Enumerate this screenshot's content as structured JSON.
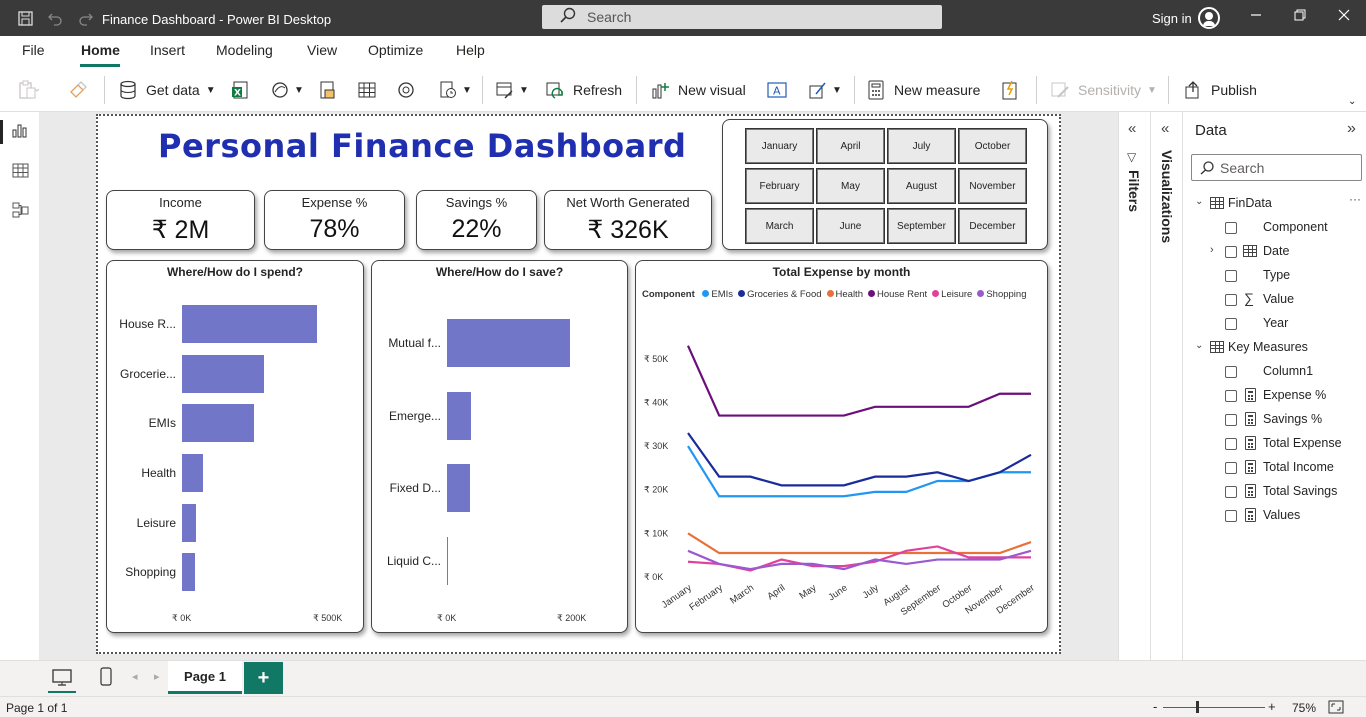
{
  "window": {
    "title": "Finance Dashboard - Power BI Desktop",
    "search_placeholder": "Search",
    "sign_in": "Sign in"
  },
  "menu": [
    "File",
    "Home",
    "Insert",
    "Modeling",
    "View",
    "Optimize",
    "Help"
  ],
  "ribbon": {
    "get_data": "Get data",
    "refresh": "Refresh",
    "new_visual": "New visual",
    "new_measure": "New measure",
    "sensitivity": "Sensitivity",
    "publish": "Publish"
  },
  "dashboard": {
    "title": "Personal Finance Dashboard",
    "kpis": [
      {
        "label": "Income",
        "value": "₹ 2M"
      },
      {
        "label": "Expense %",
        "value": "78%"
      },
      {
        "label": "Savings %",
        "value": "22%"
      },
      {
        "label": "Net Worth Generated",
        "value": "₹ 326K"
      }
    ],
    "months": [
      "January",
      "April",
      "July",
      "October",
      "February",
      "May",
      "August",
      "November",
      "March",
      "June",
      "September",
      "December"
    ]
  },
  "chart_data": [
    {
      "type": "bar",
      "title": "Where/How do I spend?",
      "categories": [
        "House R...",
        "Grocerie...",
        "EMIs",
        "Health",
        "Leisure",
        "Shopping"
      ],
      "values": [
        480000,
        290000,
        255000,
        75000,
        50000,
        45000
      ],
      "xlim": [
        0,
        560000
      ],
      "xticks": [
        "₹ 0K",
        "₹ 500K"
      ],
      "color": "#7276c8"
    },
    {
      "type": "bar",
      "title": "Where/How do I save?",
      "categories": [
        "Mutual f...",
        "Emerge...",
        "Fixed D...",
        "Liquid C..."
      ],
      "values": [
        205000,
        40000,
        38000,
        2000
      ],
      "xlim": [
        0,
        240000
      ],
      "xticks": [
        "₹ 0K",
        "₹ 200K"
      ],
      "color": "#7276c8"
    },
    {
      "type": "line",
      "title": "Total Expense by month",
      "legend_title": "Component",
      "x": [
        "January",
        "February",
        "March",
        "April",
        "May",
        "June",
        "July",
        "August",
        "September",
        "October",
        "November",
        "December"
      ],
      "ylim": [
        0,
        55000
      ],
      "yticks": [
        "₹ 0K",
        "₹ 10K",
        "₹ 20K",
        "₹ 30K",
        "₹ 40K",
        "₹ 50K"
      ],
      "series": [
        {
          "name": "EMIs",
          "color": "#2196f3",
          "values": [
            30000,
            18500,
            18500,
            18500,
            18500,
            18500,
            19500,
            19500,
            22000,
            22000,
            24000,
            24000
          ]
        },
        {
          "name": "Groceries & Food",
          "color": "#1a2b9a",
          "values": [
            33000,
            23000,
            23000,
            21000,
            21000,
            21000,
            23000,
            23000,
            24000,
            22000,
            24000,
            28000
          ]
        },
        {
          "name": "Health",
          "color": "#e8703a",
          "values": [
            10000,
            5500,
            5500,
            5500,
            5500,
            5500,
            5500,
            5500,
            5500,
            5500,
            5500,
            8000
          ]
        },
        {
          "name": "House Rent",
          "color": "#6b0f7a",
          "values": [
            53000,
            37000,
            37000,
            37000,
            37000,
            37000,
            39000,
            39000,
            39000,
            39000,
            42000,
            42000
          ]
        },
        {
          "name": "Leisure",
          "color": "#e0429b",
          "values": [
            3500,
            3000,
            1500,
            4000,
            2500,
            2500,
            3500,
            6000,
            7000,
            4500,
            4500,
            4500
          ]
        },
        {
          "name": "Shopping",
          "color": "#9b59d0",
          "values": [
            6000,
            3000,
            1800,
            3000,
            3000,
            1800,
            4000,
            3000,
            4000,
            4000,
            4000,
            6000
          ]
        }
      ]
    }
  ],
  "panels": {
    "filters": "Filters",
    "visualizations": "Visualizations",
    "data": "Data",
    "search_placeholder": "Search"
  },
  "data_fields": {
    "table1": "FinData",
    "table1_fields": [
      "Component",
      "Date",
      "Type",
      "Value",
      "Year"
    ],
    "table2": "Key Measures",
    "table2_fields": [
      "Column1",
      "Expense %",
      "Savings %",
      "Total Expense",
      "Total Income",
      "Total Savings",
      "Values"
    ]
  },
  "pages": {
    "current": "Page 1",
    "add": "+"
  },
  "status": {
    "page": "Page 1 of 1",
    "zoom": "75%",
    "zoom_minus": "-",
    "zoom_plus": "+"
  }
}
